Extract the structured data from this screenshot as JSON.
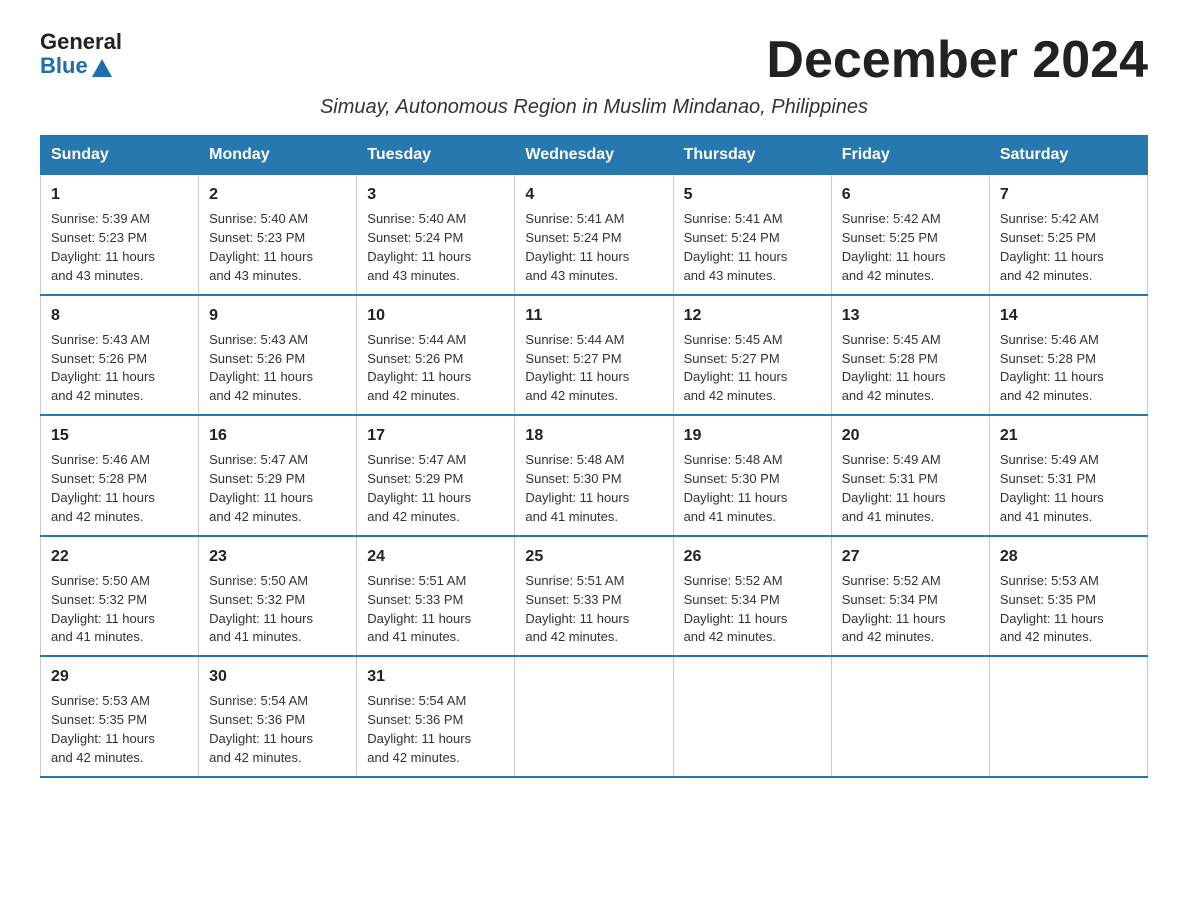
{
  "header": {
    "logo_general": "General",
    "logo_blue": "Blue",
    "month_title": "December 2024",
    "subtitle": "Simuay, Autonomous Region in Muslim Mindanao, Philippines"
  },
  "days_of_week": [
    "Sunday",
    "Monday",
    "Tuesday",
    "Wednesday",
    "Thursday",
    "Friday",
    "Saturday"
  ],
  "weeks": [
    [
      {
        "day": "1",
        "sunrise": "5:39 AM",
        "sunset": "5:23 PM",
        "daylight": "11 hours and 43 minutes."
      },
      {
        "day": "2",
        "sunrise": "5:40 AM",
        "sunset": "5:23 PM",
        "daylight": "11 hours and 43 minutes."
      },
      {
        "day": "3",
        "sunrise": "5:40 AM",
        "sunset": "5:24 PM",
        "daylight": "11 hours and 43 minutes."
      },
      {
        "day": "4",
        "sunrise": "5:41 AM",
        "sunset": "5:24 PM",
        "daylight": "11 hours and 43 minutes."
      },
      {
        "day": "5",
        "sunrise": "5:41 AM",
        "sunset": "5:24 PM",
        "daylight": "11 hours and 43 minutes."
      },
      {
        "day": "6",
        "sunrise": "5:42 AM",
        "sunset": "5:25 PM",
        "daylight": "11 hours and 42 minutes."
      },
      {
        "day": "7",
        "sunrise": "5:42 AM",
        "sunset": "5:25 PM",
        "daylight": "11 hours and 42 minutes."
      }
    ],
    [
      {
        "day": "8",
        "sunrise": "5:43 AM",
        "sunset": "5:26 PM",
        "daylight": "11 hours and 42 minutes."
      },
      {
        "day": "9",
        "sunrise": "5:43 AM",
        "sunset": "5:26 PM",
        "daylight": "11 hours and 42 minutes."
      },
      {
        "day": "10",
        "sunrise": "5:44 AM",
        "sunset": "5:26 PM",
        "daylight": "11 hours and 42 minutes."
      },
      {
        "day": "11",
        "sunrise": "5:44 AM",
        "sunset": "5:27 PM",
        "daylight": "11 hours and 42 minutes."
      },
      {
        "day": "12",
        "sunrise": "5:45 AM",
        "sunset": "5:27 PM",
        "daylight": "11 hours and 42 minutes."
      },
      {
        "day": "13",
        "sunrise": "5:45 AM",
        "sunset": "5:28 PM",
        "daylight": "11 hours and 42 minutes."
      },
      {
        "day": "14",
        "sunrise": "5:46 AM",
        "sunset": "5:28 PM",
        "daylight": "11 hours and 42 minutes."
      }
    ],
    [
      {
        "day": "15",
        "sunrise": "5:46 AM",
        "sunset": "5:28 PM",
        "daylight": "11 hours and 42 minutes."
      },
      {
        "day": "16",
        "sunrise": "5:47 AM",
        "sunset": "5:29 PM",
        "daylight": "11 hours and 42 minutes."
      },
      {
        "day": "17",
        "sunrise": "5:47 AM",
        "sunset": "5:29 PM",
        "daylight": "11 hours and 42 minutes."
      },
      {
        "day": "18",
        "sunrise": "5:48 AM",
        "sunset": "5:30 PM",
        "daylight": "11 hours and 41 minutes."
      },
      {
        "day": "19",
        "sunrise": "5:48 AM",
        "sunset": "5:30 PM",
        "daylight": "11 hours and 41 minutes."
      },
      {
        "day": "20",
        "sunrise": "5:49 AM",
        "sunset": "5:31 PM",
        "daylight": "11 hours and 41 minutes."
      },
      {
        "day": "21",
        "sunrise": "5:49 AM",
        "sunset": "5:31 PM",
        "daylight": "11 hours and 41 minutes."
      }
    ],
    [
      {
        "day": "22",
        "sunrise": "5:50 AM",
        "sunset": "5:32 PM",
        "daylight": "11 hours and 41 minutes."
      },
      {
        "day": "23",
        "sunrise": "5:50 AM",
        "sunset": "5:32 PM",
        "daylight": "11 hours and 41 minutes."
      },
      {
        "day": "24",
        "sunrise": "5:51 AM",
        "sunset": "5:33 PM",
        "daylight": "11 hours and 41 minutes."
      },
      {
        "day": "25",
        "sunrise": "5:51 AM",
        "sunset": "5:33 PM",
        "daylight": "11 hours and 42 minutes."
      },
      {
        "day": "26",
        "sunrise": "5:52 AM",
        "sunset": "5:34 PM",
        "daylight": "11 hours and 42 minutes."
      },
      {
        "day": "27",
        "sunrise": "5:52 AM",
        "sunset": "5:34 PM",
        "daylight": "11 hours and 42 minutes."
      },
      {
        "day": "28",
        "sunrise": "5:53 AM",
        "sunset": "5:35 PM",
        "daylight": "11 hours and 42 minutes."
      }
    ],
    [
      {
        "day": "29",
        "sunrise": "5:53 AM",
        "sunset": "5:35 PM",
        "daylight": "11 hours and 42 minutes."
      },
      {
        "day": "30",
        "sunrise": "5:54 AM",
        "sunset": "5:36 PM",
        "daylight": "11 hours and 42 minutes."
      },
      {
        "day": "31",
        "sunrise": "5:54 AM",
        "sunset": "5:36 PM",
        "daylight": "11 hours and 42 minutes."
      },
      null,
      null,
      null,
      null
    ]
  ],
  "labels": {
    "sunrise": "Sunrise:",
    "sunset": "Sunset:",
    "daylight": "Daylight:"
  }
}
